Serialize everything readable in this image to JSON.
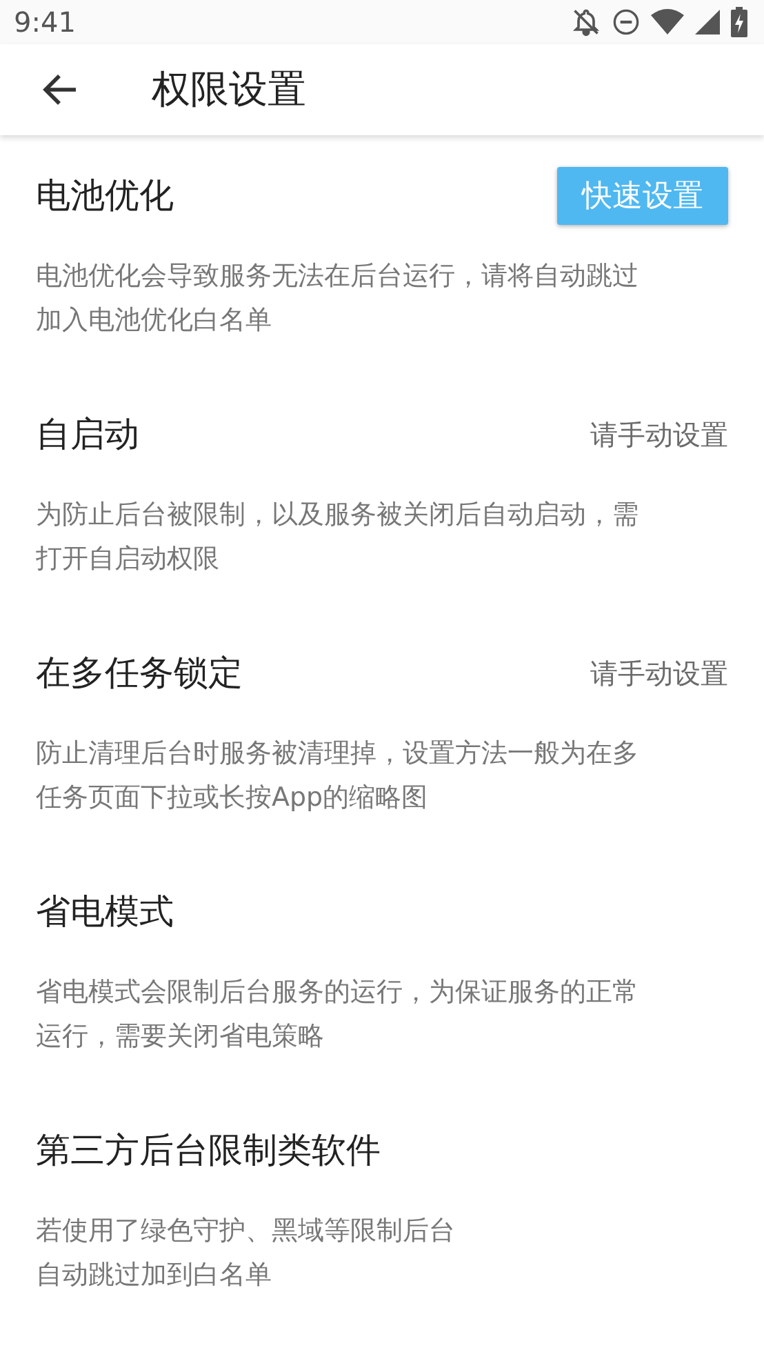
{
  "status_bar": {
    "time": "9:41"
  },
  "toolbar": {
    "title": "权限设置"
  },
  "items": [
    {
      "title": "电池优化",
      "action": {
        "kind": "button",
        "label": "快速设置"
      },
      "description": [
        "电池优化会导致服务无法在后台运行，请将自动跳过",
        "加入电池优化白名单"
      ]
    },
    {
      "title": "自启动",
      "action": {
        "kind": "text",
        "label": "请手动设置"
      },
      "description": [
        "为防止后台被限制，以及服务被关闭后自动启动，需",
        "打开自启动权限"
      ]
    },
    {
      "title": "在多任务锁定",
      "action": {
        "kind": "text",
        "label": "请手动设置"
      },
      "description": [
        "防止清理后台时服务被清理掉，设置方法一般为在多",
        "任务页面下拉或长按App的缩略图"
      ]
    },
    {
      "title": "省电模式",
      "description": [
        "省电模式会限制后台服务的运行，为保证服务的正常",
        "运行，需要关闭省电策略"
      ]
    },
    {
      "title": "第三方后台限制类软件",
      "description": [
        "若使用了绿色守护、黑域等限制后台",
        "自动跳过加到白名单"
      ]
    }
  ]
}
